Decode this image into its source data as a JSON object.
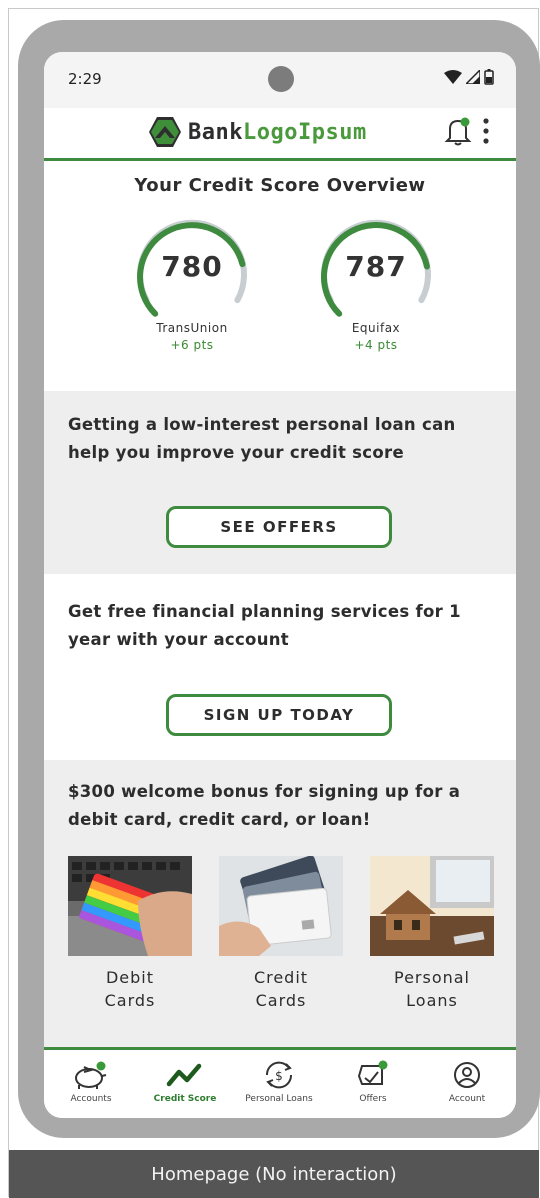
{
  "status_bar": {
    "time": "2:29"
  },
  "app_bar": {
    "logo_bank": "Bank",
    "logo_ipsum": "LogoIpsum"
  },
  "credit_overview": {
    "title": "Your Credit Score Overview",
    "scores": [
      {
        "bureau": "TransUnion",
        "score": "780",
        "change": "+6 pts",
        "gauge_fill": 0.78
      },
      {
        "bureau": "Equifax",
        "score": "787",
        "change": "+4 pts",
        "gauge_fill": 0.79
      }
    ]
  },
  "promo_loan": {
    "text": "Getting a low-interest personal loan can help you improve your credit score",
    "button": "SEE OFFERS"
  },
  "promo_planning": {
    "text": "Get free financial planning services for 1 year with your account",
    "button": "SIGN UP TODAY"
  },
  "promo_bonus": {
    "text": "$300 welcome bonus for signing up for a debit card, credit card, or loan!",
    "cards": [
      {
        "label_1": "Debit",
        "label_2": "Cards"
      },
      {
        "label_1": "Credit",
        "label_2": "Cards"
      },
      {
        "label_1": "Personal",
        "label_2": "Loans"
      }
    ]
  },
  "nav": {
    "items": [
      {
        "label": "Accounts",
        "icon": "piggy-bank-icon"
      },
      {
        "label": "Credit Score",
        "icon": "trend-line-icon",
        "active": true
      },
      {
        "label": "Personal Loans",
        "icon": "dollar-cycle-icon"
      },
      {
        "label": "Offers",
        "icon": "offers-icon"
      },
      {
        "label": "Account",
        "icon": "user-circle-icon"
      }
    ]
  },
  "caption": "Homepage (No interaction)",
  "colors": {
    "brand_green": "#3e8a3e",
    "notification_dot": "#3a9a3a",
    "gauge_track": "#c7cdd1"
  }
}
